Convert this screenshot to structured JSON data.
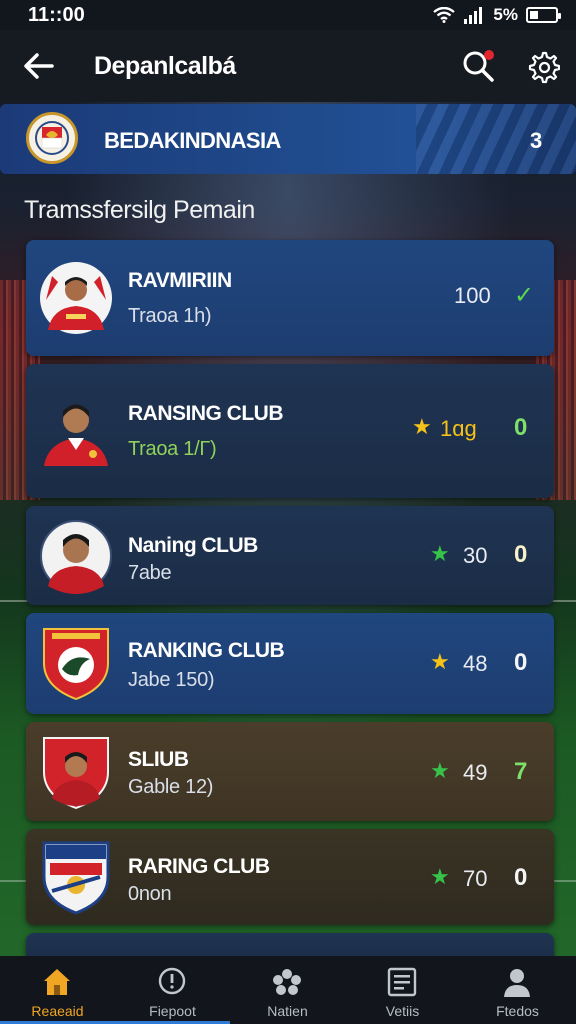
{
  "status_bar": {
    "time": "11::00",
    "battery": "5%"
  },
  "header": {
    "title": "Depanlcalbá"
  },
  "league": {
    "name": "BEDAKINDNASIA",
    "count": "3"
  },
  "section": {
    "title": "Tramssfersilg Pemain"
  },
  "players": [
    {
      "name": "RAVMIRIIN",
      "sub": "Traoa 1h)",
      "score": "100",
      "star": "",
      "right": "✓",
      "right_color": "green"
    },
    {
      "name": "RANSING CLUB",
      "sub": "Traoa 1/Γ)",
      "score": "1ɑg",
      "star": "gold",
      "right": "0",
      "right_color": "lime"
    },
    {
      "name": "Naning CLUB",
      "sub": "7abe",
      "score": "30",
      "star": "green",
      "right": "0",
      "right_color": "yellow"
    },
    {
      "name": "RANKING CLUB",
      "sub": "Jabe 150)",
      "score": "48",
      "star": "gold",
      "right": "0",
      "right_color": "white"
    },
    {
      "name": "SLIUB",
      "sub": "Gable 12)",
      "score": "49",
      "star": "green",
      "right": "7",
      "right_color": "lime"
    },
    {
      "name": "RARING CLUB",
      "sub": "0non",
      "score": "70",
      "star": "green",
      "right": "0",
      "right_color": "white"
    }
  ],
  "nav": [
    {
      "label": "Reaeaid",
      "icon": "home-icon",
      "active": true
    },
    {
      "label": "Fiepoot",
      "icon": "alert-icon",
      "active": false
    },
    {
      "label": "Natien",
      "icon": "flower-icon",
      "active": false
    },
    {
      "label": "Vetiis",
      "icon": "list-icon",
      "active": false
    },
    {
      "label": "Ftedos",
      "icon": "user-icon",
      "active": false
    }
  ],
  "colors": {
    "accent": "#f0a623",
    "banner": "#1f4b8d",
    "star_gold": "#f5c218",
    "star_green": "#37c24a"
  }
}
